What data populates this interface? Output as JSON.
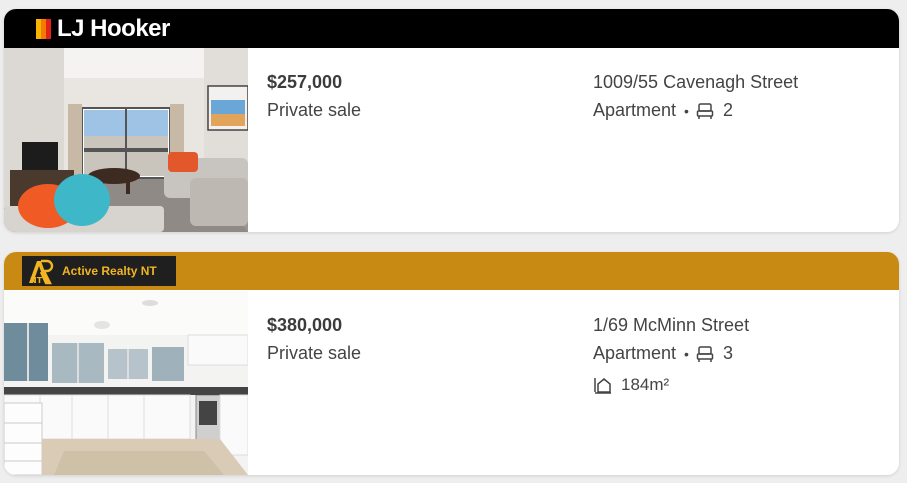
{
  "listings": [
    {
      "agency": "LJ Hooker",
      "agency_color": "#000000",
      "price": "$257,000",
      "sale_type": "Private sale",
      "address": "1009/55 Cavenagh Street",
      "property_type": "Apartment",
      "separator": "•",
      "bedrooms": "2",
      "photo_icon": "living-room-photo"
    },
    {
      "agency": "Active Realty NT",
      "agency_color": "#c98a14",
      "price": "$380,000",
      "sale_type": "Private sale",
      "address": "1/69 McMinn Street",
      "property_type": "Apartment",
      "separator": "•",
      "bedrooms": "3",
      "land_area": "184m²",
      "photo_icon": "kitchen-photo"
    }
  ]
}
